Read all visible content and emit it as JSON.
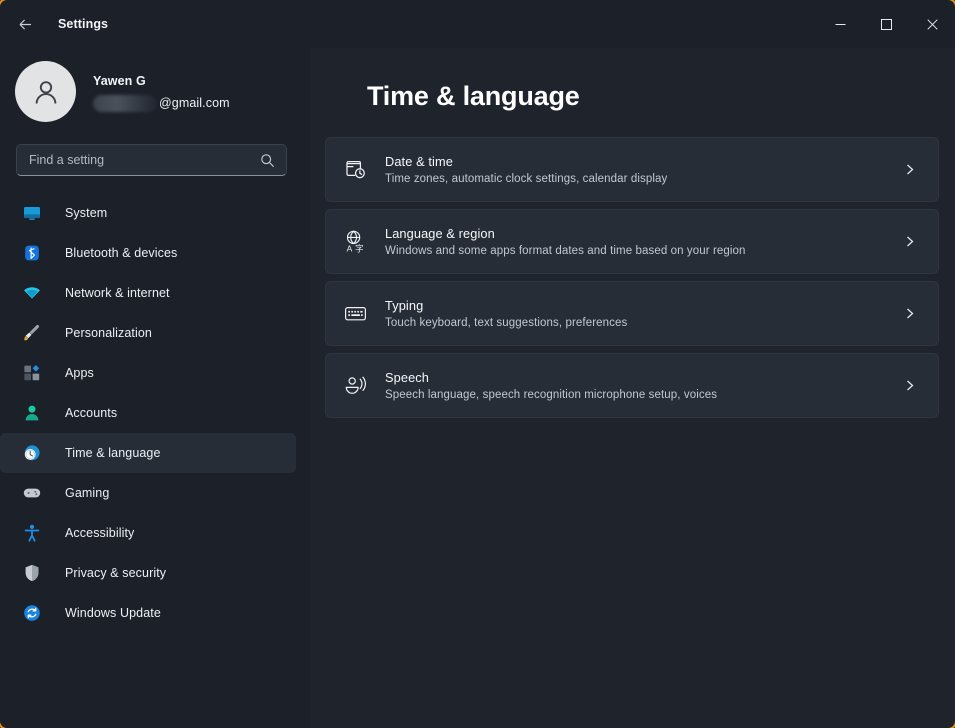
{
  "window": {
    "app_title": "Settings",
    "back_label": "Back",
    "accent_color": "#e8950f",
    "controls": [
      {
        "name": "minimize",
        "glyph": "minimize-icon"
      },
      {
        "name": "maximize",
        "glyph": "maximize-icon"
      },
      {
        "name": "close",
        "glyph": "close-icon"
      }
    ]
  },
  "sidebar": {
    "account": {
      "name": "Yawen G",
      "email_visible": "@gmail.com",
      "email_redacted": true,
      "avatar_icon": "person-icon"
    },
    "search": {
      "placeholder": "Find a setting",
      "value": "",
      "icon": "search-icon"
    },
    "items": [
      {
        "label": "System",
        "icon": "monitor-icon",
        "selected": false
      },
      {
        "label": "Bluetooth & devices",
        "icon": "bluetooth-icon",
        "selected": false
      },
      {
        "label": "Network & internet",
        "icon": "wifi-icon",
        "selected": false
      },
      {
        "label": "Personalization",
        "icon": "paintbrush-icon",
        "selected": false
      },
      {
        "label": "Apps",
        "icon": "apps-icon",
        "selected": false
      },
      {
        "label": "Accounts",
        "icon": "account-icon",
        "selected": false
      },
      {
        "label": "Time & language",
        "icon": "clock-globe-icon",
        "selected": true
      },
      {
        "label": "Gaming",
        "icon": "gamepad-icon",
        "selected": false
      },
      {
        "label": "Accessibility",
        "icon": "accessibility-icon",
        "selected": false
      },
      {
        "label": "Privacy & security",
        "icon": "shield-icon",
        "selected": false
      },
      {
        "label": "Windows Update",
        "icon": "update-icon",
        "selected": false
      }
    ]
  },
  "main": {
    "page_title": "Time & language",
    "cards": [
      {
        "title": "Date & time",
        "desc": "Time zones, automatic clock settings, calendar display",
        "icon": "calendar-clock-icon",
        "chevron": "chevron-right-icon"
      },
      {
        "title": "Language & region",
        "desc": "Windows and some apps format dates and time based on your region",
        "icon": "globe-language-icon",
        "chevron": "chevron-right-icon"
      },
      {
        "title": "Typing",
        "desc": "Touch keyboard, text suggestions, preferences",
        "icon": "keyboard-icon",
        "chevron": "chevron-right-icon"
      },
      {
        "title": "Speech",
        "desc": "Speech language, speech recognition microphone setup, voices",
        "icon": "speech-icon",
        "chevron": "chevron-right-icon"
      }
    ]
  }
}
